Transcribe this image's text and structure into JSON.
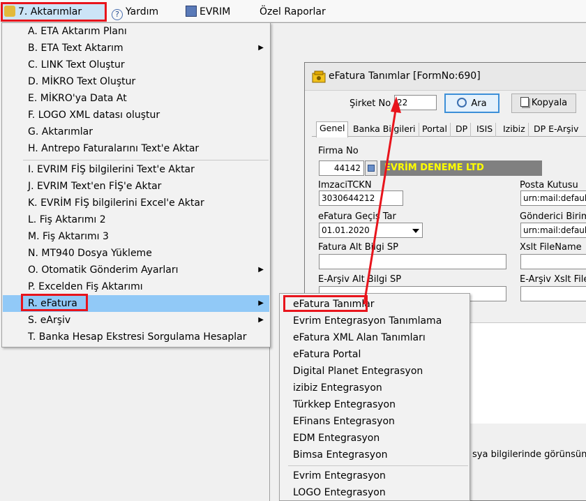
{
  "menubar": {
    "items": [
      {
        "label": "7.  Aktarımlar"
      },
      {
        "label": "Yardım"
      },
      {
        "label": "EVRIM"
      },
      {
        "label": "Özel Raporlar"
      }
    ]
  },
  "menu": {
    "items": [
      {
        "label": "A.  ETA Aktarım Planı"
      },
      {
        "label": "B.  ETA Text Aktarım",
        "submenu": true
      },
      {
        "label": "C.  LINK Text Oluştur"
      },
      {
        "label": "D.  MİKRO Text Oluştur"
      },
      {
        "label": "E.  MİKRO'ya  Data  At"
      },
      {
        "label": "F.  LOGO XML datası oluştur"
      },
      {
        "label": "G.  Aktarımlar"
      },
      {
        "label": "H.  Antrepo Faturalarını Text'e Aktar"
      },
      {
        "label": "I.  EVRIM FİŞ bilgilerini Text'e Aktar"
      },
      {
        "label": "J.  EVRIM Text'en FİŞ'e Aktar"
      },
      {
        "label": "K.  EVRİM FİŞ bilgilerini Excel'e Aktar"
      },
      {
        "label": "L.  Fiş Aktarımı 2"
      },
      {
        "label": "M.  Fiş Aktarımı 3"
      },
      {
        "label": "N.  MT940 Dosya Yükleme"
      },
      {
        "label": "O. Otomatik Gönderim Ayarları",
        "submenu": true
      },
      {
        "label": "P.  Excelden Fiş Aktarımı"
      },
      {
        "label": "R. eFatura",
        "submenu": true
      },
      {
        "label": "S.  eArşiv",
        "submenu": true
      },
      {
        "label": "T. Banka Hesap Ekstresi Sorgulama Hesaplar"
      }
    ]
  },
  "submenu": {
    "items": [
      {
        "label": "eFatura Tanımlar"
      },
      {
        "label": "Evrim Entegrasyon Tanımlama"
      },
      {
        "label": "eFatura XML Alan Tanımları"
      },
      {
        "label": "eFatura Portal"
      },
      {
        "label": "Digital Planet Entegrasyon"
      },
      {
        "label": "izibiz Entegrasyon"
      },
      {
        "label": "Türkkep Entegrasyon"
      },
      {
        "label": "EFinans Entegrasyon"
      },
      {
        "label": "EDM Entegrasyon"
      },
      {
        "label": "Bimsa Entegrasyon"
      },
      {
        "label": "Evrim Entegrasyon"
      },
      {
        "label": "LOGO Entegrasyon"
      }
    ]
  },
  "window": {
    "title": "eFatura Tanımlar [FormNo:690]",
    "sirket_label": "Şirket No",
    "sirket_value": "22",
    "ara_label": "Ara",
    "kopyala_label": "Kopyala",
    "tabs": [
      "Genel",
      "Banka Bilgileri",
      "Portal",
      "DP",
      "ISIS",
      "Izibiz",
      "DP E-Arşiv"
    ],
    "firma_label": "Firma No",
    "firma_value": "44142",
    "firma_name": "EVRİM DENEME LTD",
    "imzaci_label": "ImzaciTCKN",
    "imzaci_value": "3030644212",
    "posta_label": "Posta Kutusu",
    "posta_value": "urn:mail:defaultp",
    "gecis_label": "eFatura Geçiş Tar",
    "gecis_value": "01.01.2020",
    "gonderici_label": "Gönderici Birim",
    "gonderici_value": "urn:mail:defaultg",
    "fatura_alt_label": "Fatura Alt Bilgi SP",
    "xslt_label": "Xslt FileName",
    "earsiv_alt_label": "E-Arşiv Alt Bilgi SP",
    "earsiv_xslt_label": "E-Arşiv Xslt FileN",
    "bottom_text": "sya bilgilerinde görünsün"
  },
  "colors": {
    "highlight": "#cce4f7",
    "menu_highlight": "#91c9f7",
    "annotation_red": "#e8141c",
    "firma_name_bg": "#808080",
    "firma_name_fg": "#ffff00"
  }
}
